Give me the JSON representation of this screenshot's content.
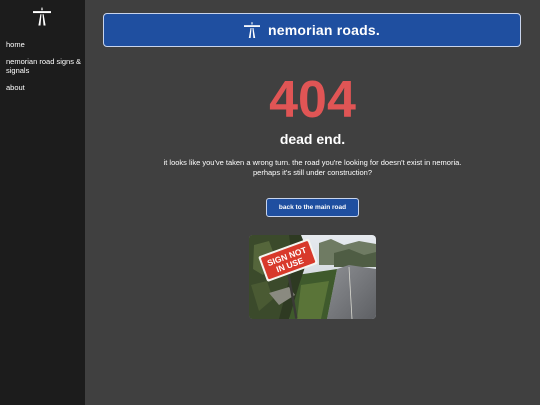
{
  "sidebar": {
    "logo_icon": "motorway-icon",
    "nav": [
      {
        "label": "home"
      },
      {
        "label": "nemorian road signs & signals"
      },
      {
        "label": "about"
      }
    ]
  },
  "header": {
    "logo_icon": "motorway-icon",
    "title": "nemorian roads."
  },
  "error": {
    "code": "404",
    "title": "dead end.",
    "message_line1": "it looks like you've taken a wrong turn. the road you're looking for doesn't exist in nemoria.",
    "message_line2": "perhaps it's still under construction?",
    "button_label": "back to the main road"
  },
  "photo": {
    "sign_text_line1": "SIGN NOT",
    "sign_text_line2": "IN USE"
  },
  "colors": {
    "accent_blue": "#1f4fa0",
    "error_red": "#e05555",
    "sidebar_bg": "#1c1c1c",
    "main_bg": "#404040"
  }
}
